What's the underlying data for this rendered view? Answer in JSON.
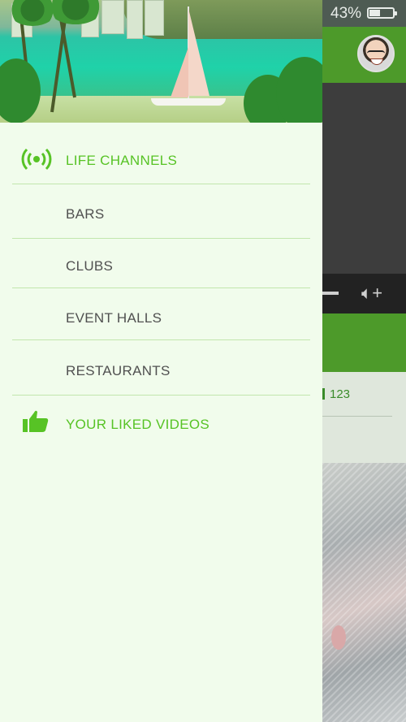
{
  "status_bar": {
    "battery_percent": "43%",
    "battery_level": 0.43
  },
  "drawer": {
    "items": [
      {
        "label": "LIFE CHANNELS",
        "icon": "broadcast-icon",
        "accent": true
      },
      {
        "label": "BARS",
        "icon": null,
        "accent": false
      },
      {
        "label": "CLUBS",
        "icon": null,
        "accent": false
      },
      {
        "label": "EVENT HALLS",
        "icon": null,
        "accent": false
      },
      {
        "label": "RESTAURANTS",
        "icon": null,
        "accent": false
      },
      {
        "label": "YOUR LIKED VIDEOS",
        "icon": "thumbs-up-icon",
        "accent": true
      }
    ]
  },
  "background_app": {
    "like_count": "123"
  },
  "colors": {
    "accent_green": "#57c325",
    "header_green": "#4d9a2a",
    "drawer_background": "#f1fcec",
    "menu_text": "#505050",
    "divider": "#c2e6ad"
  }
}
